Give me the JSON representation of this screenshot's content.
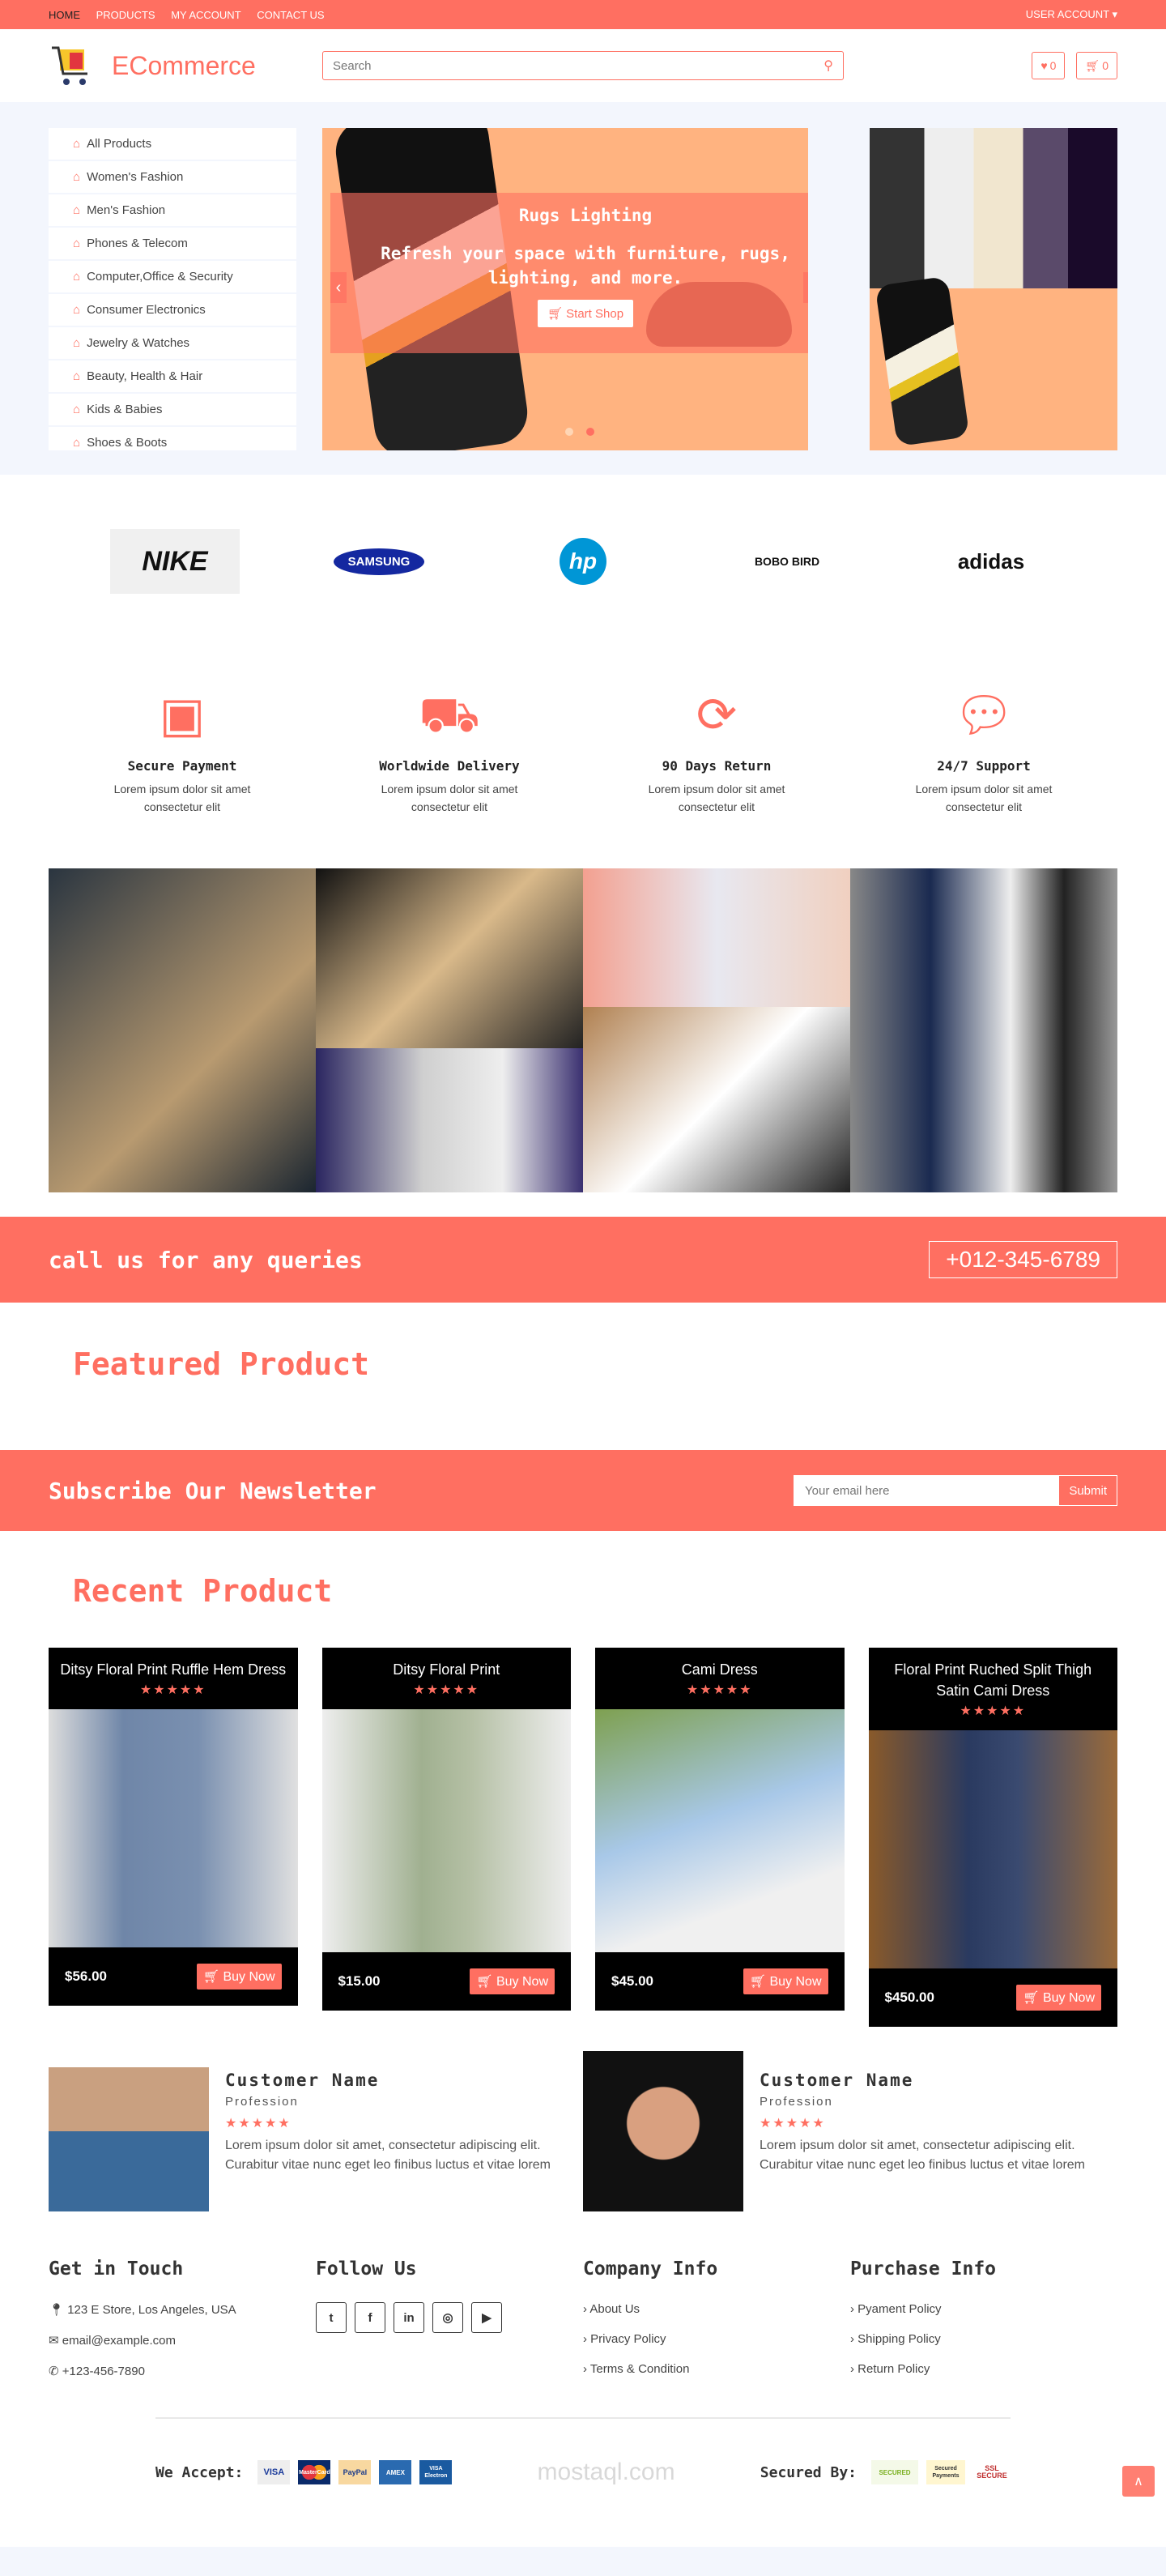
{
  "colors": {
    "accent": "#ff6f61",
    "hero_bg": "#f3f6fd"
  },
  "topbar": {
    "links": [
      "HOME",
      "PRODUCTS",
      "MY ACCOUNT",
      "CONTACT US"
    ],
    "user_account": "USER ACCOUNT ▾"
  },
  "header": {
    "brand": "ECommerce",
    "search_placeholder": "Search",
    "wishlist_count": "0",
    "cart_count": "0"
  },
  "sidebar": {
    "items": [
      "All Products",
      "Women's Fashion",
      "Men's Fashion",
      "Phones & Telecom",
      "Computer,Office & Security",
      "Consumer Electronics",
      "Jewelry & Watches",
      "Beauty, Health & Hair",
      "Kids & Babies",
      "Shoes & Boots"
    ]
  },
  "carousel": {
    "title": "Rugs Lighting",
    "text": "Refresh your space with furniture, rugs, lighting, and more.",
    "button": "Start Shop",
    "active_slide": 2,
    "slides": 2
  },
  "brands": [
    "NIKE",
    "SAMSUNG",
    "hp",
    "BOBO BIRD",
    "adidas"
  ],
  "features": [
    {
      "icon": "credit-card-icon",
      "title": "Secure Payment",
      "text": "Lorem ipsum dolor sit amet consectetur elit"
    },
    {
      "icon": "truck-icon",
      "title": "Worldwide Delivery",
      "text": "Lorem ipsum dolor sit amet consectetur elit"
    },
    {
      "icon": "refresh-icon",
      "title": "90 Days Return",
      "text": "Lorem ipsum dolor sit amet consectetur elit"
    },
    {
      "icon": "comments-icon",
      "title": "24/7 Support",
      "text": "Lorem ipsum dolor sit amet consectetur elit"
    }
  ],
  "callbar": {
    "text": "call us for any queries",
    "phone": "+012-345-6789"
  },
  "featured": {
    "title": "Featured Product"
  },
  "newsletter": {
    "title": "Subscribe Our Newsletter",
    "placeholder": "Your email here",
    "button": "Submit"
  },
  "recent": {
    "title": "Recent Product"
  },
  "products": [
    {
      "name": "Ditsy Floral Print Ruffle Hem Dress",
      "rating": 5,
      "price": "$56.00",
      "button": "Buy Now"
    },
    {
      "name": "Ditsy Floral Print",
      "rating": 5,
      "price": "$15.00",
      "button": "Buy Now"
    },
    {
      "name": "Cami Dress",
      "rating": 5,
      "price": "$45.00",
      "button": "Buy Now"
    },
    {
      "name": "Floral Print Ruched Split Thigh Satin Cami Dress",
      "rating": 5,
      "price": "$450.00",
      "button": "Buy Now"
    }
  ],
  "testimonials": [
    {
      "name": "Customer Name",
      "profession": "Profession",
      "rating": 5,
      "text": "Lorem ipsum dolor sit amet, consectetur adipiscing elit. Curabitur vitae nunc eget leo finibus luctus et vitae lorem"
    },
    {
      "name": "Customer Name",
      "profession": "Profession",
      "rating": 5,
      "text": "Lorem ipsum dolor sit amet, consectetur adipiscing elit. Curabitur vitae nunc eget leo finibus luctus et vitae lorem"
    }
  ],
  "footer": {
    "contact": {
      "title": "Get in Touch",
      "address": "123 E Store, Los Angeles, USA",
      "email": "email@example.com",
      "phone": "+123-456-7890"
    },
    "follow": {
      "title": "Follow Us",
      "icons": [
        "twitter-icon",
        "facebook-icon",
        "linkedin-icon",
        "instagram-icon",
        "youtube-icon"
      ]
    },
    "company": {
      "title": "Company Info",
      "links": [
        "About Us",
        "Privacy Policy",
        "Terms & Condition"
      ]
    },
    "purchase": {
      "title": "Purchase Info",
      "links": [
        "Pyament Policy",
        "Shipping Policy",
        "Return Policy"
      ]
    },
    "accept_label": "We Accept:",
    "payments": [
      "VISA",
      "MasterCard",
      "PayPal",
      "AMEX",
      "VISA Electron"
    ],
    "secured_label": "Secured By:",
    "secured": [
      "SECURED",
      "Secured Payments",
      "SSL SECURE"
    ],
    "watermark": "mostaql.com"
  }
}
